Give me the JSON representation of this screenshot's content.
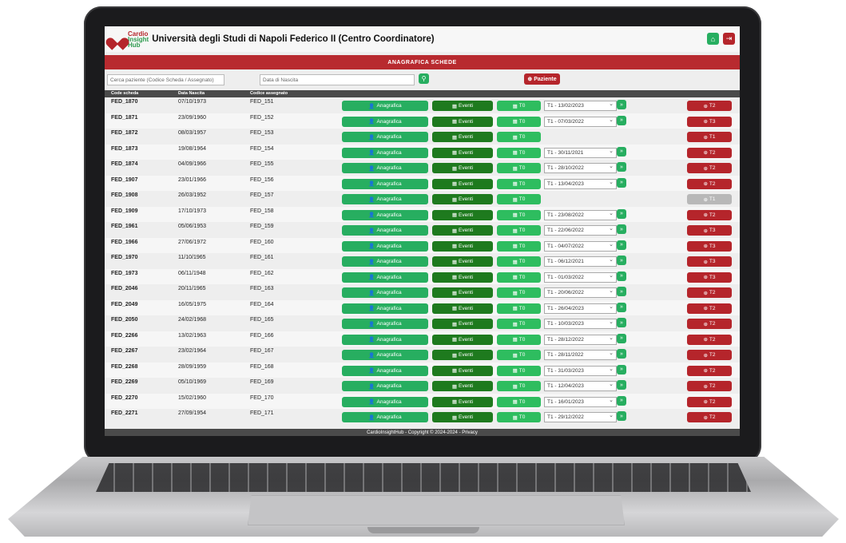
{
  "app": {
    "logo_line1": "Cardio",
    "logo_line2": "Insight",
    "logo_line3": "Hub",
    "title": "Università degli Studi di Napoli Federico II (Centro Coordinatore)",
    "section_title": "ANAGRAFICA SCHEDE"
  },
  "icons": {
    "home": "home-icon",
    "logout": "logout-icon",
    "search": "search-icon",
    "plus": "plus-circle-icon"
  },
  "filters": {
    "search_placeholder": "Cerca paziente (Codice Scheda / Assegnato)",
    "dob_placeholder": "Data di Nascita",
    "new_patient_label": "Paziente"
  },
  "table": {
    "headers": [
      "Code scheda",
      "Data Nascita",
      "Codice assegnato"
    ],
    "anagrafica_label": "Anagrafica",
    "eventi_label": "Eventi",
    "t0_label": "T0",
    "rows": [
      {
        "code": "FED_1870",
        "dob": "07/10/1973",
        "assigned": "FED_151",
        "visit": "T1 - 13/02/2023",
        "next": "T2"
      },
      {
        "code": "FED_1871",
        "dob": "23/09/1960",
        "assigned": "FED_152",
        "visit": "T1 - 07/03/2022",
        "next": "T3"
      },
      {
        "code": "FED_1872",
        "dob": "08/03/1957",
        "assigned": "FED_153",
        "visit": "",
        "next": "T1"
      },
      {
        "code": "FED_1873",
        "dob": "19/08/1964",
        "assigned": "FED_154",
        "visit": "T1 - 30/11/2021",
        "next": "T2"
      },
      {
        "code": "FED_1874",
        "dob": "04/09/1966",
        "assigned": "FED_155",
        "visit": "T1 - 28/10/2022",
        "next": "T2"
      },
      {
        "code": "FED_1907",
        "dob": "23/01/1966",
        "assigned": "FED_156",
        "visit": "T1 - 13/04/2023",
        "next": "T2"
      },
      {
        "code": "FED_1908",
        "dob": "26/03/1952",
        "assigned": "FED_157",
        "visit": "",
        "next": "T1"
      },
      {
        "code": "FED_1909",
        "dob": "17/10/1973",
        "assigned": "FED_158",
        "visit": "T1 - 23/08/2022",
        "next": "T2"
      },
      {
        "code": "FED_1961",
        "dob": "05/06/1953",
        "assigned": "FED_159",
        "visit": "T1 - 22/06/2022",
        "next": "T3"
      },
      {
        "code": "FED_1966",
        "dob": "27/06/1972",
        "assigned": "FED_160",
        "visit": "T1 - 04/07/2022",
        "next": "T3"
      },
      {
        "code": "FED_1970",
        "dob": "11/10/1965",
        "assigned": "FED_161",
        "visit": "T1 - 06/12/2021",
        "next": "T3"
      },
      {
        "code": "FED_1973",
        "dob": "06/11/1948",
        "assigned": "FED_162",
        "visit": "T1 - 01/03/2022",
        "next": "T3"
      },
      {
        "code": "FED_2046",
        "dob": "20/11/1965",
        "assigned": "FED_163",
        "visit": "T1 - 20/06/2022",
        "next": "T2"
      },
      {
        "code": "FED_2049",
        "dob": "16/05/1975",
        "assigned": "FED_164",
        "visit": "T1 - 26/04/2023",
        "next": "T2"
      },
      {
        "code": "FED_2050",
        "dob": "24/02/1968",
        "assigned": "FED_165",
        "visit": "T1 - 10/03/2023",
        "next": "T2"
      },
      {
        "code": "FED_2266",
        "dob": "13/02/1963",
        "assigned": "FED_166",
        "visit": "T1 - 28/12/2022",
        "next": "T2"
      },
      {
        "code": "FED_2267",
        "dob": "23/02/1964",
        "assigned": "FED_167",
        "visit": "T1 - 28/11/2022",
        "next": "T2"
      },
      {
        "code": "FED_2268",
        "dob": "28/09/1959",
        "assigned": "FED_168",
        "visit": "T1 - 31/03/2023",
        "next": "T2"
      },
      {
        "code": "FED_2269",
        "dob": "05/10/1969",
        "assigned": "FED_169",
        "visit": "T1 - 12/04/2023",
        "next": "T2"
      },
      {
        "code": "FED_2270",
        "dob": "15/02/1960",
        "assigned": "FED_170",
        "visit": "T1 - 16/01/2023",
        "next": "T2"
      },
      {
        "code": "FED_2271",
        "dob": "27/09/1954",
        "assigned": "FED_171",
        "visit": "T1 - 29/12/2022",
        "next": "T2"
      }
    ]
  },
  "footer": {
    "text": "CardioInsightHub - Copyright © 2024-2024 - Privacy"
  },
  "colors": {
    "brand_red": "#b82a2f",
    "brand_green": "#27ae60",
    "dark_green": "#1e7a1e",
    "disabled": "#b8b8b8"
  }
}
